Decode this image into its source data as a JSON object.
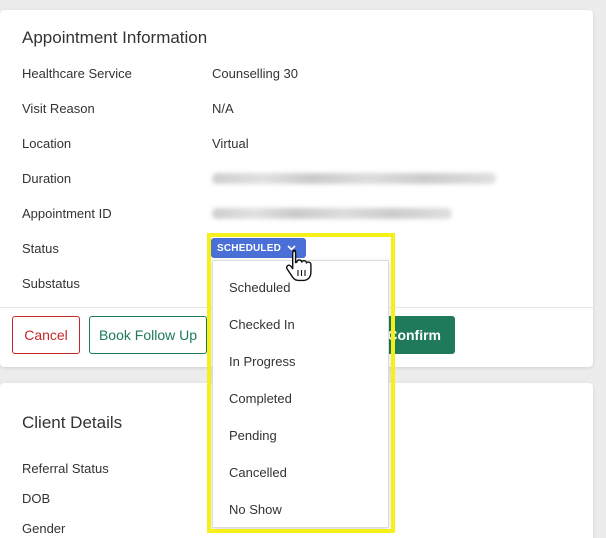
{
  "appointment": {
    "title": "Appointment Information",
    "fields": [
      {
        "label": "Healthcare Service",
        "value": "Counselling 30"
      },
      {
        "label": "Visit Reason",
        "value": "N/A"
      },
      {
        "label": "Location",
        "value": "Virtual"
      },
      {
        "label": "Duration",
        "value": ""
      },
      {
        "label": "Appointment ID",
        "value": ""
      },
      {
        "label": "Status",
        "value": ""
      },
      {
        "label": "Substatus",
        "value": ""
      }
    ],
    "status_badge": "SCHEDULED",
    "buttons": {
      "cancel": "Cancel",
      "follow_up": "Book Follow Up",
      "confirm": "Confirm"
    }
  },
  "status_dropdown": {
    "options": [
      "Scheduled",
      "Checked In",
      "In Progress",
      "Completed",
      "Pending",
      "Cancelled",
      "No Show"
    ]
  },
  "client": {
    "title": "Client Details",
    "fields": [
      {
        "label": "Referral Status"
      },
      {
        "label": "DOB"
      },
      {
        "label": "Gender"
      }
    ]
  },
  "colors": {
    "badge": "#4a6fd6",
    "cancel": "#c62828",
    "primary": "#1e7a5a",
    "highlight": "#f5f01a"
  }
}
